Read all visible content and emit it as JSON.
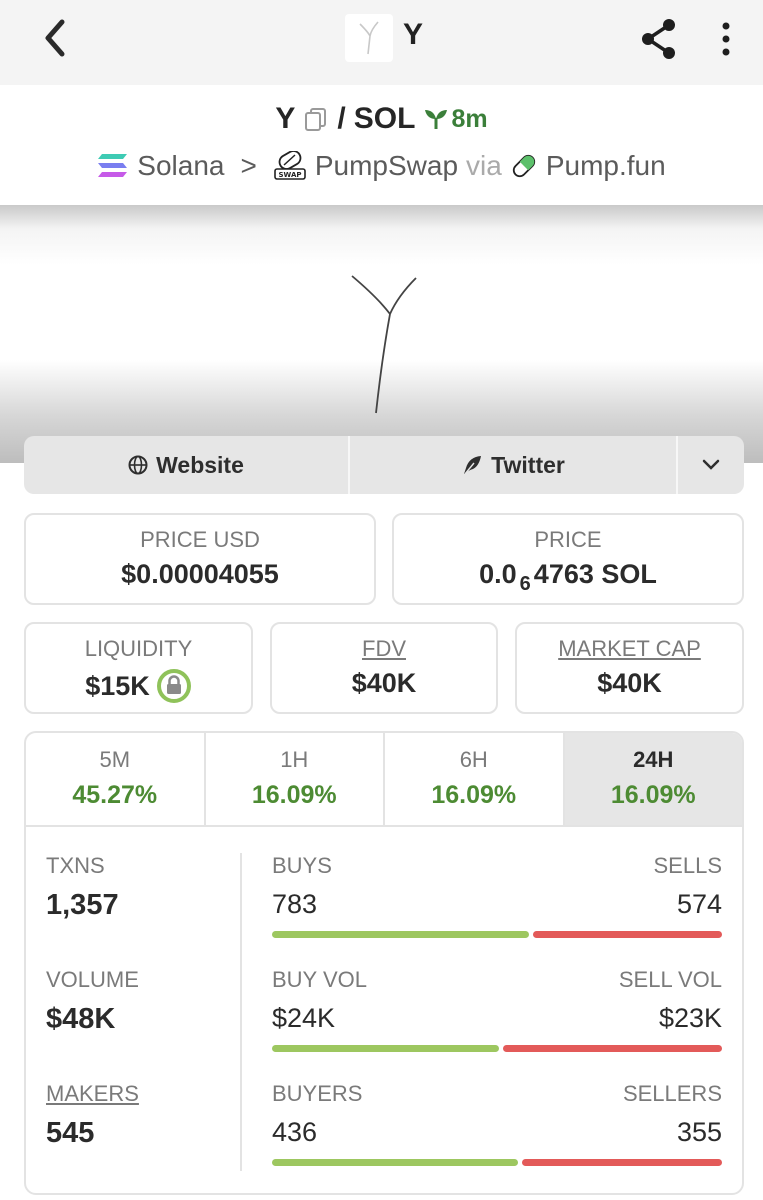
{
  "header": {
    "title": "Y",
    "logo_letter": "Y"
  },
  "pair": {
    "base": "Y",
    "separator": "/",
    "quote": "SOL",
    "age": "8m"
  },
  "chain": {
    "name": "Solana",
    "sep": ">",
    "dex": "PumpSwap",
    "via": "via",
    "launchpad": "Pump.fun"
  },
  "links": {
    "website": "Website",
    "twitter": "Twitter"
  },
  "stats": {
    "price_usd_label": "PRICE USD",
    "price_usd": "$0.00004055",
    "price_label": "PRICE",
    "price_prefix": "0.0",
    "price_subscript": "6",
    "price_suffix": "4763 SOL",
    "liquidity_label": "LIQUIDITY",
    "liquidity": "$15K",
    "fdv_label": "FDV",
    "fdv": "$40K",
    "mcap_label": "MARKET CAP",
    "mcap": "$40K"
  },
  "timeframes": [
    {
      "label": "5M",
      "change": "45.27%"
    },
    {
      "label": "1H",
      "change": "16.09%"
    },
    {
      "label": "6H",
      "change": "16.09%"
    },
    {
      "label": "24H",
      "change": "16.09%"
    }
  ],
  "metrics": {
    "txns_label": "TXNS",
    "txns": "1,357",
    "volume_label": "VOLUME",
    "volume": "$48K",
    "makers_label": "MAKERS",
    "makers": "545"
  },
  "splits": {
    "buys_label": "BUYS",
    "buys": "783",
    "sells_label": "SELLS",
    "sells": "574",
    "buy_vol_label": "BUY VOL",
    "buy_vol": "$24K",
    "sell_vol_label": "SELL VOL",
    "sell_vol": "$23K",
    "buyers_label": "BUYERS",
    "buyers": "436",
    "sellers_label": "SELLERS",
    "sellers": "355"
  },
  "bar_ratios": {
    "buys": 0.577,
    "buy_vol": 0.51,
    "buyers": 0.551
  },
  "colors": {
    "positive": "#4d8b33",
    "buy_bar": "#9dc760",
    "sell_bar": "#e35a59"
  }
}
